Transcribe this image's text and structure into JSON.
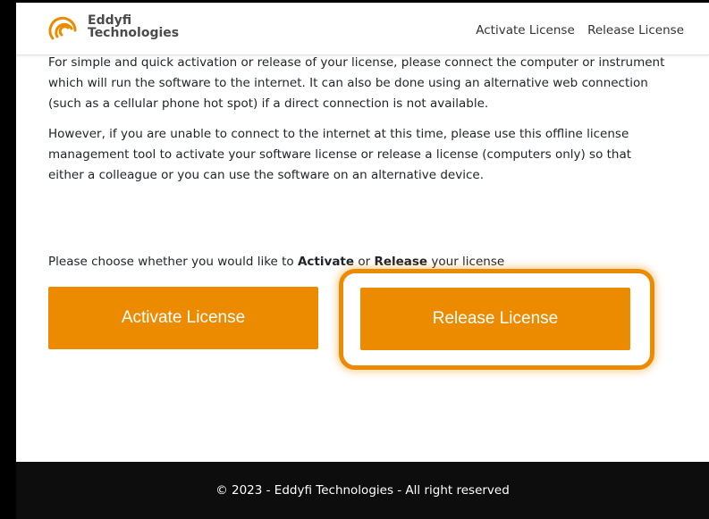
{
  "header": {
    "logo_line1": "Eddyfi",
    "logo_line2": "Technologies",
    "nav": {
      "activate": "Activate License",
      "release": "Release License"
    }
  },
  "main": {
    "paragraph1": "For simple and quick activation or release of your license, please connect the computer or instrument which will run the software to the internet. It can also be done using an alternative web connection (such as a cellular phone hot spot) if a direct connection is not available.",
    "paragraph2": "However, if you are unable to connect to the internet at this time, please use this offline license management tool to activate your software license or release a license (computers only) so that either a colleague or you can use the software on an alternative device.",
    "choose_prefix": "Please choose whether you would like to ",
    "choose_activate": "Activate",
    "choose_or": " or ",
    "choose_release": "Release",
    "choose_suffix": " your license"
  },
  "buttons": {
    "activate": "Activate License",
    "release": "Release License"
  },
  "footer": {
    "text": "© 2023 - Eddyfi Technologies - All right reserved"
  },
  "colors": {
    "accent": "#ed8b00",
    "footer_bg": "#0d0d0d",
    "text": "#212529"
  }
}
